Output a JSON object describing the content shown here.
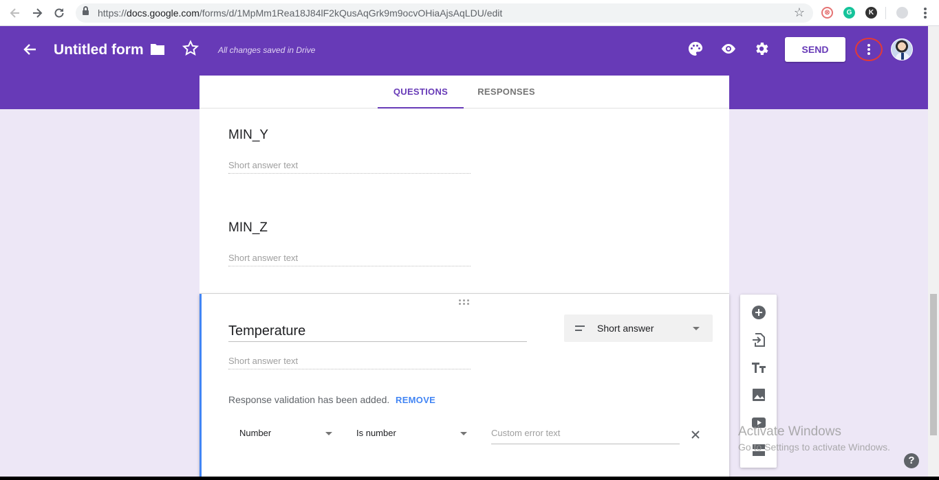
{
  "browser": {
    "url_scheme": "https://",
    "url_host": "docs.google.com",
    "url_path": "/forms/d/1MpMm1Rea18J84lF2kQusAqGrk9m9ocvOHiaAjsAqLDU/edit"
  },
  "header": {
    "title": "Untitled form",
    "save_status": "All changes saved in Drive",
    "send_label": "SEND"
  },
  "tabs": [
    {
      "label": "QUESTIONS",
      "active": true
    },
    {
      "label": "RESPONSES",
      "active": false
    }
  ],
  "questions": [
    {
      "title": "MIN_Y",
      "placeholder": "Short answer text"
    },
    {
      "title": "MIN_Z",
      "placeholder": "Short answer text"
    }
  ],
  "active_question": {
    "title": "Temperature",
    "type": "Short answer",
    "placeholder": "Short answer text",
    "validation_message": "Response validation has been added.",
    "remove_label": "REMOVE",
    "validation_category": "Number",
    "validation_rule": "Is number",
    "error_placeholder": "Custom error text"
  },
  "watermark": {
    "title": "Activate Windows",
    "subtitle": "Go to Settings to activate Windows."
  },
  "help": "?",
  "colors": {
    "brand": "#673ab7",
    "background": "#ede7f6",
    "active_accent": "#4285f4",
    "highlight_circle": "#e53935"
  }
}
